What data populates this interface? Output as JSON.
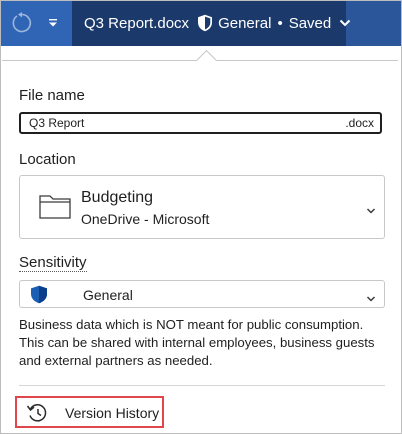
{
  "titlebar": {
    "doc_title": "Q3 Report.docx",
    "sensitivity": "General",
    "separator": "•",
    "save_status": "Saved",
    "colors": {
      "bar": "#2b579a",
      "active": "#1b3a6b"
    },
    "icons": [
      "undo-icon",
      "qat-dropdown-icon",
      "shield-icon",
      "chevron-down-icon"
    ]
  },
  "panel": {
    "file_name": {
      "label": "File name",
      "value": "Q3 Report",
      "extension": ".docx"
    },
    "location": {
      "label": "Location",
      "name": "Budgeting",
      "sub": "OneDrive - Microsoft",
      "icon": "folder-icon"
    },
    "sensitivity": {
      "label": "Sensitivity",
      "value": "General",
      "icon": "shield-icon",
      "description": "Business data which is NOT meant for public consumption. This can be shared with internal employees, business guests and external partners as needed."
    },
    "version_history": {
      "label": "Version History",
      "icon": "history-icon",
      "highlight_color": "#e0474c"
    }
  }
}
